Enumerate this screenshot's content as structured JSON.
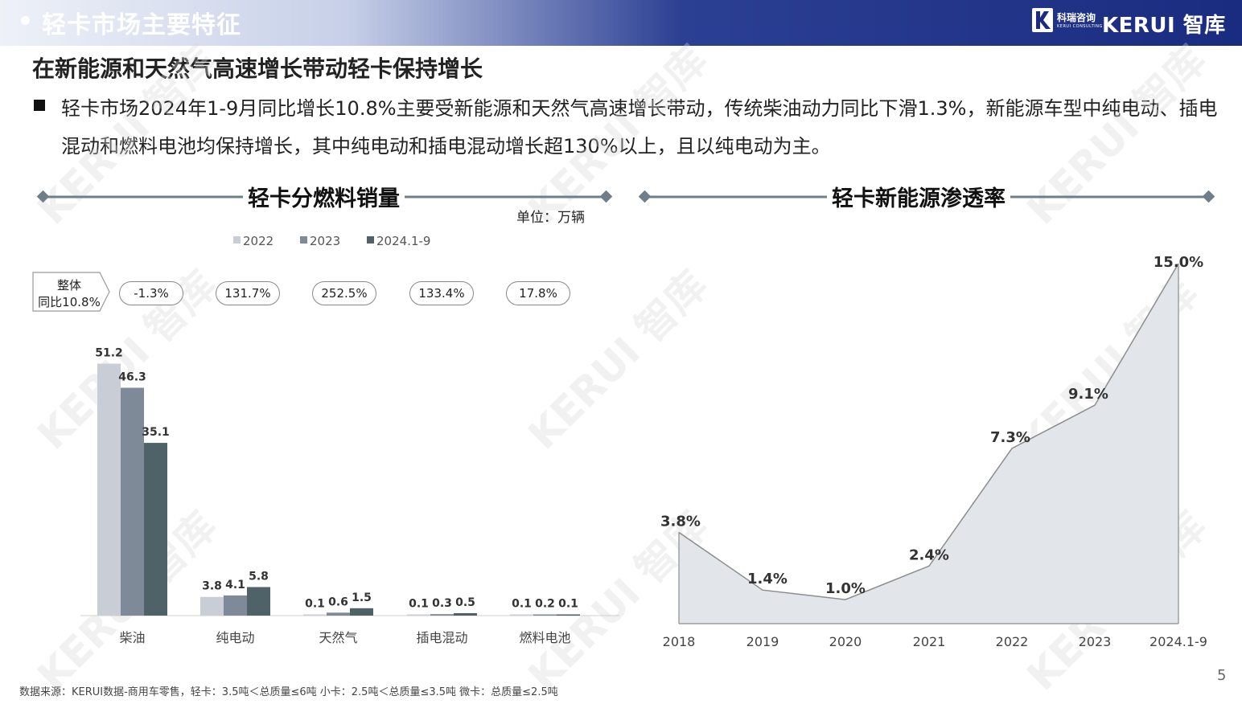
{
  "header": {
    "title": "轻卡市场主要特征",
    "logo_cn": "科瑞咨询",
    "logo_en": "KERUI CONSULTING",
    "brand": "KERUI 智库"
  },
  "headline": "在新能源和天然气高速增长带动轻卡保持增长",
  "paragraph": "轻卡市场2024年1-9月同比增长10.8%主要受新能源和天然气高速增长带动，传统柴油动力同比下滑1.3%，新能源车型中纯电动、插电混动和燃料电池均保持增长，其中纯电动和插电混动增长超130%以上，且以纯电动为主。",
  "left_section": {
    "title": "轻卡分燃料销量",
    "unit": "单位：万辆",
    "overall_line1": "整体",
    "overall_line2": "同比10.8%",
    "growth_pills": [
      "-1.3%",
      "131.7%",
      "252.5%",
      "133.4%",
      "17.8%"
    ]
  },
  "right_section": {
    "title": "轻卡新能源渗透率"
  },
  "footer": "数据来源：KERUI数据-商用车零售，轻卡：3.5吨＜总质量≤6吨  小卡：2.5吨＜总质量≤3.5吨  微卡：总质量≤2.5吨",
  "page_number": "5",
  "watermark": "KERUI 智库",
  "colors": {
    "header_blue": "#1a2c80",
    "series_2022": "#c9ced6",
    "series_2023": "#7f8a99",
    "series_2024": "#4e6268",
    "area_fill": "#e2e6ea",
    "line": "#8c8c8c",
    "section_line": "#6e7f8a"
  },
  "chart_data": [
    {
      "type": "bar",
      "title": "轻卡分燃料销量",
      "categories": [
        "柴油",
        "纯电动",
        "天然气",
        "插电混动",
        "燃料电池"
      ],
      "series": [
        {
          "name": "2022",
          "values": [
            51.2,
            3.8,
            0.1,
            0.1,
            0.1
          ],
          "labels": [
            "51.2",
            "3.8",
            "0.1",
            "0.1",
            "0.1"
          ]
        },
        {
          "name": "2023",
          "values": [
            46.3,
            4.1,
            0.6,
            0.3,
            0.2
          ],
          "labels": [
            "46.3",
            "4.1",
            "0.6",
            "0.3",
            "0.2"
          ]
        },
        {
          "name": "2024.1-9",
          "values": [
            35.1,
            5.8,
            1.5,
            0.5,
            0.1
          ],
          "labels": [
            "35.1",
            "5.8",
            "1.5",
            "0.5",
            "0.1"
          ]
        }
      ],
      "ylim": [
        0,
        56
      ],
      "grid": false,
      "legend": "top"
    },
    {
      "type": "area",
      "title": "轻卡新能源渗透率",
      "categories": [
        "2018",
        "2019",
        "2020",
        "2021",
        "2022",
        "2023",
        "2024.1-9"
      ],
      "values": [
        3.8,
        1.4,
        1.0,
        2.4,
        7.3,
        9.1,
        15.0
      ],
      "labels": [
        "3.8%",
        "1.4%",
        "1.0%",
        "2.4%",
        "7.3%",
        "9.1%",
        "15.0%"
      ],
      "ylim": [
        0,
        15
      ],
      "grid": false
    }
  ]
}
